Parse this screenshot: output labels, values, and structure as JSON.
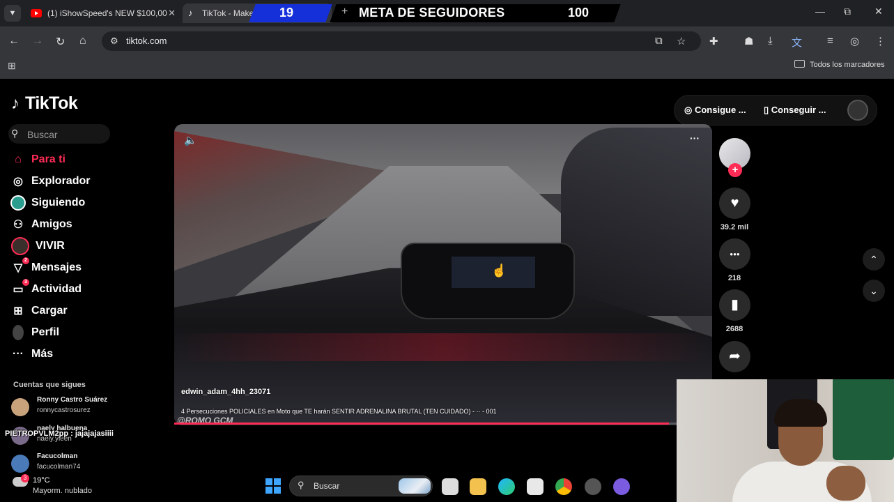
{
  "browser": {
    "tabs": [
      {
        "title": "(1) iShowSpeed's NEW $100,00",
        "close": "✕"
      },
      {
        "title": "TikTok - Make Y",
        "close": "✕"
      }
    ],
    "new_tab": "+",
    "window": {
      "minimize": "—",
      "maximize": "⧉",
      "close": "✕"
    },
    "url": "tiktok.com",
    "bookmarks_label": "Todos los marcadores"
  },
  "goal_overlay": {
    "current": "19",
    "title": "META DE SEGUIDORES",
    "target": "100",
    "color": "#1530d8"
  },
  "tiktok": {
    "logo": "TikTok",
    "search_placeholder": "Buscar",
    "menu": [
      {
        "label": "Para ti",
        "icon": "home-icon"
      },
      {
        "label": "Explorador",
        "icon": "compass-icon"
      },
      {
        "label": "Siguiendo",
        "icon": "following-icon"
      },
      {
        "label": "Amigos",
        "icon": "friends-icon"
      },
      {
        "label": "VIVIR",
        "icon": "live-icon"
      },
      {
        "label": "Mensajes",
        "icon": "messages-icon",
        "badge": "2"
      },
      {
        "label": "Actividad",
        "icon": "activity-icon",
        "badge": "3"
      },
      {
        "label": "Cargar",
        "icon": "upload-icon"
      },
      {
        "label": "Perfil",
        "icon": "profile-icon"
      },
      {
        "label": "Más",
        "icon": "more-icon"
      }
    ],
    "following_heading": "Cuentas que sigues",
    "following": [
      {
        "name": "Ronny Castro Suárez",
        "handle": "ronnycastrosurez"
      },
      {
        "name": "naely halbuena",
        "handle": "naely.yleen"
      },
      {
        "name": "Facucolman",
        "handle": "facucolman74"
      }
    ],
    "chat_overlay": "PIETROPVLM2pp : jajajajasiiii",
    "top_buttons": [
      "Consigue ...",
      "Conseguir ..."
    ],
    "accent": "#fe2c55"
  },
  "video": {
    "author": "edwin_adam_4hh_23071",
    "description": "4 Persecuciones POLICIALES en Moto que TE harán SENTIR ADRENALINA BRUTAL (TEN CUIDADO) - ·· - 001",
    "watermark": "@ROMO GCM",
    "progress": 0.92,
    "actions": [
      {
        "icon": "heart-icon",
        "glyph": "♥",
        "count": "39.2 mil"
      },
      {
        "icon": "comment-icon",
        "glyph": "●●●",
        "count": "218"
      },
      {
        "icon": "bookmark-icon",
        "glyph": "▮",
        "count": "2688"
      },
      {
        "icon": "share-icon",
        "glyph": "➦",
        "count": ""
      }
    ]
  },
  "taskbar": {
    "weather_temp": "19°C",
    "weather_desc": "Mayorm. nublado",
    "weather_badge": "3",
    "search_label": "Buscar"
  }
}
